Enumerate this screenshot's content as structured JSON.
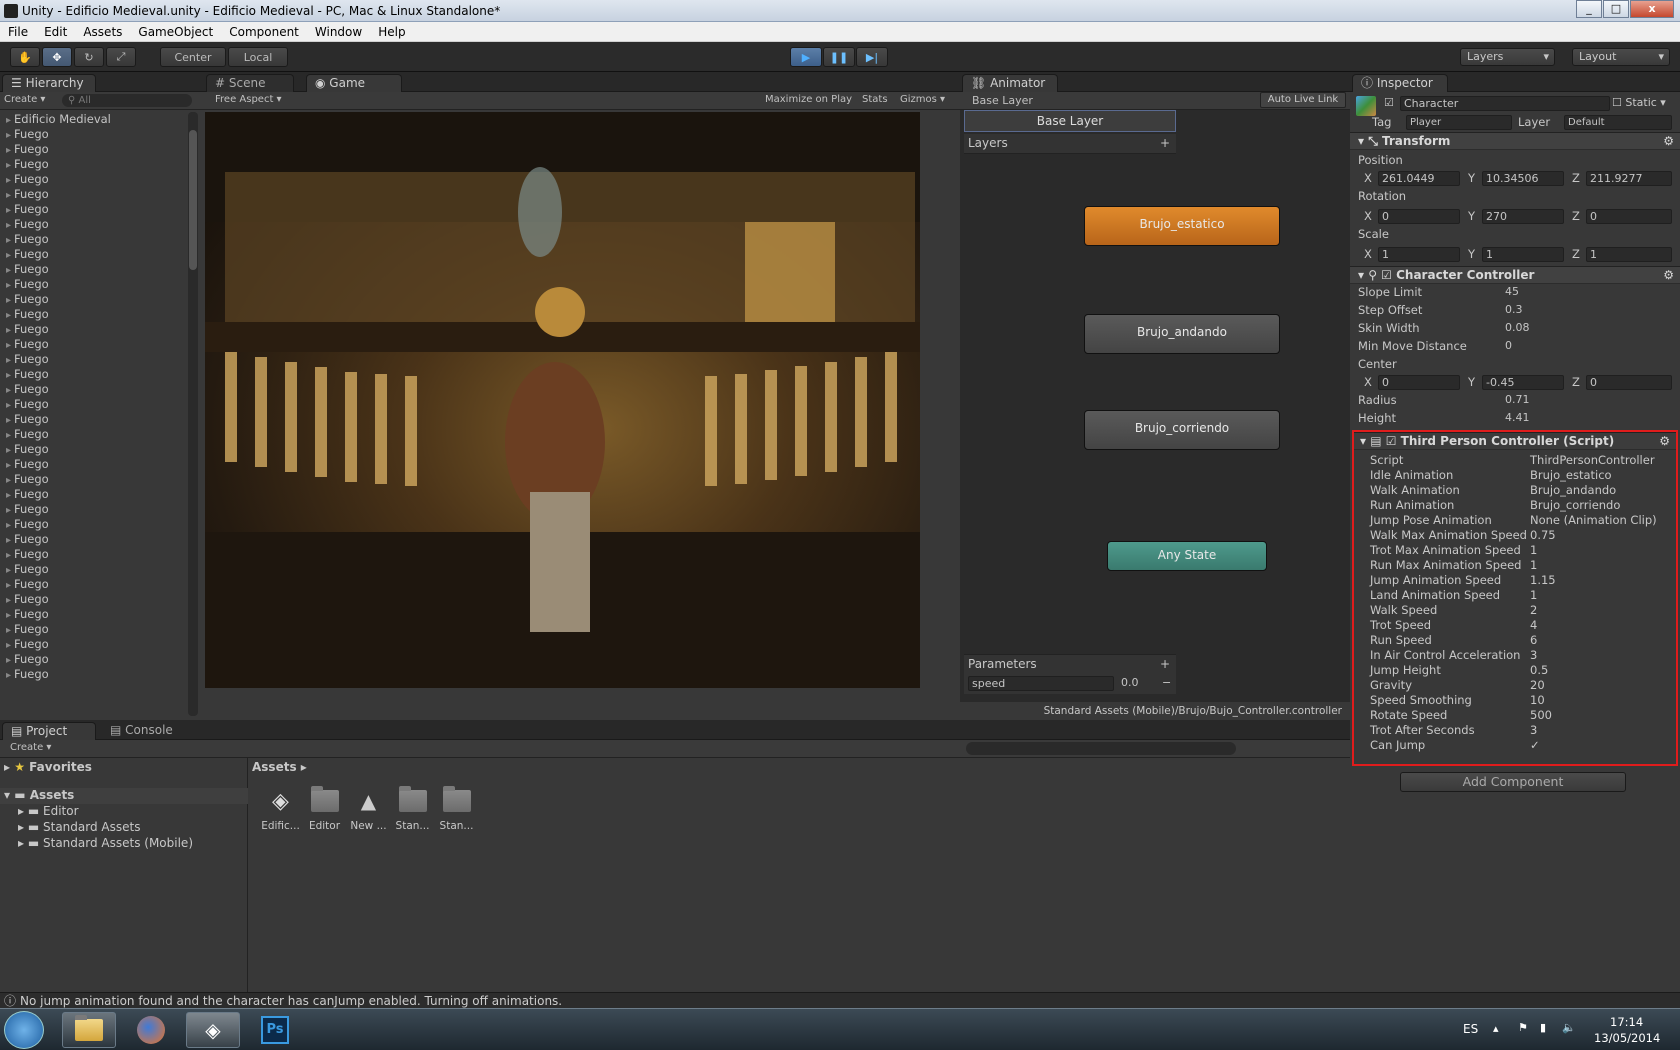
{
  "window": {
    "title": "Unity - Edificio Medieval.unity - Edificio Medieval - PC, Mac & Linux Standalone*",
    "min": "_",
    "max": "□",
    "close": "x"
  },
  "menu": [
    "File",
    "Edit",
    "Assets",
    "GameObject",
    "Component",
    "Window",
    "Help"
  ],
  "toolbar": {
    "center": "Center",
    "local": "Local",
    "layers": "Layers",
    "layout": "Layout"
  },
  "hierarchy": {
    "tab": "Hierarchy",
    "create": "Create",
    "search_placeholder": "All",
    "items": [
      "Edificio Medieval",
      "Fuego",
      "Fuego",
      "Fuego",
      "Fuego",
      "Fuego",
      "Fuego",
      "Fuego",
      "Fuego",
      "Fuego",
      "Fuego",
      "Fuego",
      "Fuego",
      "Fuego",
      "Fuego",
      "Fuego",
      "Fuego",
      "Fuego",
      "Fuego",
      "Fuego",
      "Fuego",
      "Fuego",
      "Fuego",
      "Fuego",
      "Fuego",
      "Fuego",
      "Fuego",
      "Fuego",
      "Fuego",
      "Fuego",
      "Fuego",
      "Fuego",
      "Fuego",
      "Fuego",
      "Fuego",
      "Fuego",
      "Fuego",
      "Fuego"
    ]
  },
  "game": {
    "scene_tab": "Scene",
    "game_tab": "Game",
    "aspect": "Free Aspect",
    "maximize": "Maximize on Play",
    "stats": "Stats",
    "gizmos": "Gizmos"
  },
  "animator": {
    "tab": "Animator",
    "crumb": "Base Layer",
    "layer": "Base Layer",
    "layers": "Layers",
    "autolive": "Auto Live Link",
    "states": [
      "Brujo_estatico",
      "Brujo_andando",
      "Brujo_corriendo",
      "Any State"
    ],
    "params_label": "Parameters",
    "param_name": "speed",
    "param_value": "0.0",
    "path": "Standard Assets (Mobile)/Brujo/Bujo_Controller.controller"
  },
  "inspector": {
    "tab": "Inspector",
    "name": "Character",
    "static": "Static",
    "tag_label": "Tag",
    "tag": "Player",
    "layer_label": "Layer",
    "layer": "Default",
    "transform": {
      "title": "Transform",
      "position": "Position",
      "rotation": "Rotation",
      "scale": "Scale",
      "pos": [
        "261.0449",
        "10.34506",
        "211.9277"
      ],
      "rot": [
        "0",
        "270",
        "0"
      ],
      "scl": [
        "1",
        "1",
        "1"
      ]
    },
    "cc": {
      "title": "Character Controller",
      "slope_label": "Slope Limit",
      "slope": "45",
      "step_label": "Step Offset",
      "step": "0.3",
      "skin_label": "Skin Width",
      "skin": "0.08",
      "minmove_label": "Min Move Distance",
      "minmove": "0",
      "center_label": "Center",
      "center": [
        "0",
        "-0.45",
        "0"
      ],
      "radius_label": "Radius",
      "radius": "0.71",
      "height_label": "Height",
      "height": "4.41"
    },
    "script": {
      "title": "Third Person Controller (Script)",
      "rows": [
        {
          "label": "Script",
          "value": "ThirdPersonController"
        },
        {
          "label": "Idle Animation",
          "value": "Brujo_estatico"
        },
        {
          "label": "Walk Animation",
          "value": "Brujo_andando"
        },
        {
          "label": "Run Animation",
          "value": "Brujo_corriendo"
        },
        {
          "label": "Jump Pose Animation",
          "value": "None (Animation Clip)"
        },
        {
          "label": "Walk Max Animation Speed",
          "value": "0.75"
        },
        {
          "label": "Trot Max Animation Speed",
          "value": "1"
        },
        {
          "label": "Run Max Animation Speed",
          "value": "1"
        },
        {
          "label": "Jump Animation Speed",
          "value": "1.15"
        },
        {
          "label": "Land Animation Speed",
          "value": "1"
        },
        {
          "label": "Walk Speed",
          "value": "2"
        },
        {
          "label": "Trot Speed",
          "value": "4"
        },
        {
          "label": "Run Speed",
          "value": "6"
        },
        {
          "label": "In Air Control Acceleration",
          "value": "3"
        },
        {
          "label": "Jump Height",
          "value": "0.5"
        },
        {
          "label": "Gravity",
          "value": "20"
        },
        {
          "label": "Speed Smoothing",
          "value": "10"
        },
        {
          "label": "Rotate Speed",
          "value": "500"
        },
        {
          "label": "Trot After Seconds",
          "value": "3"
        },
        {
          "label": "Can Jump",
          "value": "✓"
        }
      ]
    },
    "add_component": "Add Component"
  },
  "project": {
    "tab": "Project",
    "console_tab": "Console",
    "create": "Create",
    "favorites": "Favorites",
    "assets": "Assets",
    "tree": [
      "Editor",
      "Standard Assets",
      "Standard Assets (Mobile)"
    ],
    "crumb": "Assets",
    "files": [
      "Edific...",
      "Editor",
      "New ...",
      "Stan...",
      "Stan..."
    ]
  },
  "status": "No jump animation found and the character has canJump enabled. Turning off animations.",
  "taskbar": {
    "lang": "ES",
    "time": "17:14",
    "date": "13/05/2014"
  }
}
